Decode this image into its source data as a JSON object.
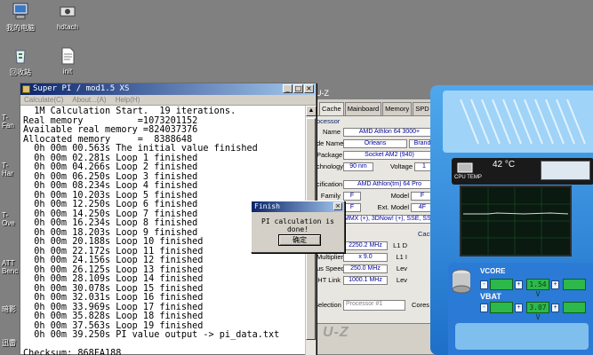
{
  "desktop": {
    "icons": [
      {
        "label": "我的电脑",
        "icon": "my-computer-icon"
      },
      {
        "label": "hdtach",
        "icon": "hdtach-icon"
      },
      {
        "label": "回收站",
        "icon": "recycle-bin-icon"
      },
      {
        "label": "init",
        "icon": "init-file-icon"
      }
    ],
    "edge_labels": [
      "T-\nFan",
      "T-\nHar",
      "T-\nOve",
      "ATT\nBenc",
      "暗影",
      "迅雷"
    ]
  },
  "superpi": {
    "title": "Super PI / mod1.5 XS",
    "menu": [
      "Calculate(C)",
      "About...(A)",
      "Help(H)"
    ],
    "lines": [
      "  1M Calculation Start.  19 iterations.",
      "Real memory          =1073201152",
      "Available real memory =824037376",
      "Allocated memory     =  8388648",
      "  0h 00m 00.563s The initial value finished",
      "  0h 00m 02.281s Loop 1 finished",
      "  0h 00m 04.266s Loop 2 finished",
      "  0h 00m 06.250s Loop 3 finished",
      "  0h 00m 08.234s Loop 4 finished",
      "  0h 00m 10.203s Loop 5 finished",
      "  0h 00m 12.250s Loop 6 finished",
      "  0h 00m 14.250s Loop 7 finished",
      "  0h 00m 16.234s Loop 8 finished",
      "  0h 00m 18.203s Loop 9 finished",
      "  0h 00m 20.188s Loop 10 finished",
      "  0h 00m 22.172s Loop 11 finished",
      "  0h 00m 24.156s Loop 12 finished",
      "  0h 00m 26.125s Loop 13 finished",
      "  0h 00m 28.109s Loop 14 finished",
      "  0h 00m 30.078s Loop 15 finished",
      "  0h 00m 32.031s Loop 16 finished",
      "  0h 00m 33.969s Loop 17 finished",
      "  0h 00m 35.828s Loop 18 finished",
      "  0h 00m 37.563s Loop 19 finished",
      "  0h 00m 39.250s PI value output -> pi_data.txt",
      "",
      "Checksum: 868FA188"
    ]
  },
  "dialog": {
    "title": "Finish",
    "message": "PI calculation is done!",
    "ok_label": "确定"
  },
  "cpuz": {
    "title": "U-Z",
    "tabs": [
      "Cache",
      "Mainboard",
      "Memory",
      "SPD"
    ],
    "group_processor": "ocessor",
    "rows": {
      "name_label": "Name",
      "name_value": "AMD Athlon 64 3000+",
      "code_label": "de Name",
      "code_value": "Orleans",
      "brand_value": "Brand",
      "package_label": "Package",
      "package_value": "Socket AM2 (940)",
      "tech_label": "chnology",
      "tech_value": "90 nm",
      "voltage_label": "Voltage",
      "voltage_value": "1",
      "spec_label": "cification",
      "spec_value": "AMD Athlon(tm) 64 Pro",
      "family_label": "Family",
      "family_value": "F",
      "model_label": "Model",
      "model_value": "F",
      "ext_family_value": "F",
      "ext_model_label": "Ext. Model",
      "ext_model_value": "4F",
      "instr_value": "MMX (+), 3DNow! (+), SSE, SSE",
      "speed_value": "2250.2 MHz",
      "mult_label": "Multiplier",
      "mult_value": "x 9.0",
      "bus_label": "us Speed",
      "bus_value": "250.0 MHz",
      "ht_label": "HT Link",
      "ht_value": "1000.1 MHz",
      "cache_group": "Cach",
      "l1d_label": "L1 D",
      "l1i_label": "L1 I",
      "lev_label": "Lev",
      "lev2_label": "Lev"
    },
    "selection_label": "Selection",
    "selection_value": "Processor #1",
    "cores_label": "Cores",
    "logo": "U-Z"
  },
  "hwmon": {
    "cpu_label": "CPU TEMP",
    "cpu_temp": "42 °C",
    "vcore_label": "VCORE",
    "vcore_value": "1.54 V",
    "vbat_label": "VBAT",
    "vbat_value": "3.07 V",
    "colors": {
      "lcd": "#2db84a",
      "frame": "#1d6fc8"
    }
  }
}
